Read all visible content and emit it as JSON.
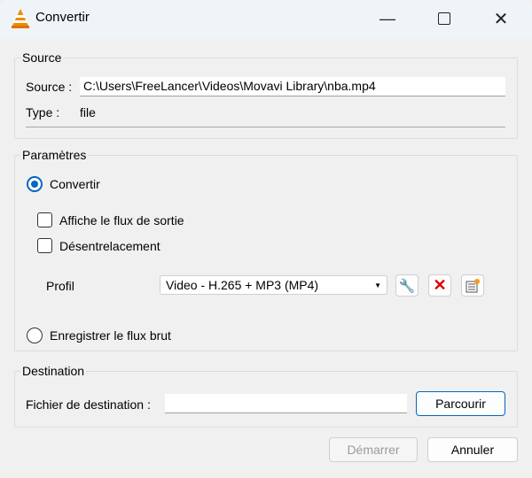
{
  "window": {
    "title": "Convertir"
  },
  "source": {
    "group_label": "Source",
    "source_label": "Source :",
    "source_value": "C:\\Users\\FreeLancer\\Videos\\Movavi Library\\nba.mp4",
    "type_label": "Type :",
    "type_value": "file"
  },
  "params": {
    "group_label": "Paramètres",
    "convert_label": "Convertir",
    "show_output_label": "Affiche le flux de sortie",
    "deinterlace_label": "Désentrelacement",
    "profile_label": "Profil",
    "profile_value": "Video - H.265 + MP3 (MP4)",
    "dump_raw_label": "Enregistrer le flux brut"
  },
  "destination": {
    "group_label": "Destination",
    "file_label": "Fichier de destination :",
    "file_value": "",
    "browse_label": "Parcourir"
  },
  "footer": {
    "start_label": "Démarrer",
    "cancel_label": "Annuler"
  }
}
